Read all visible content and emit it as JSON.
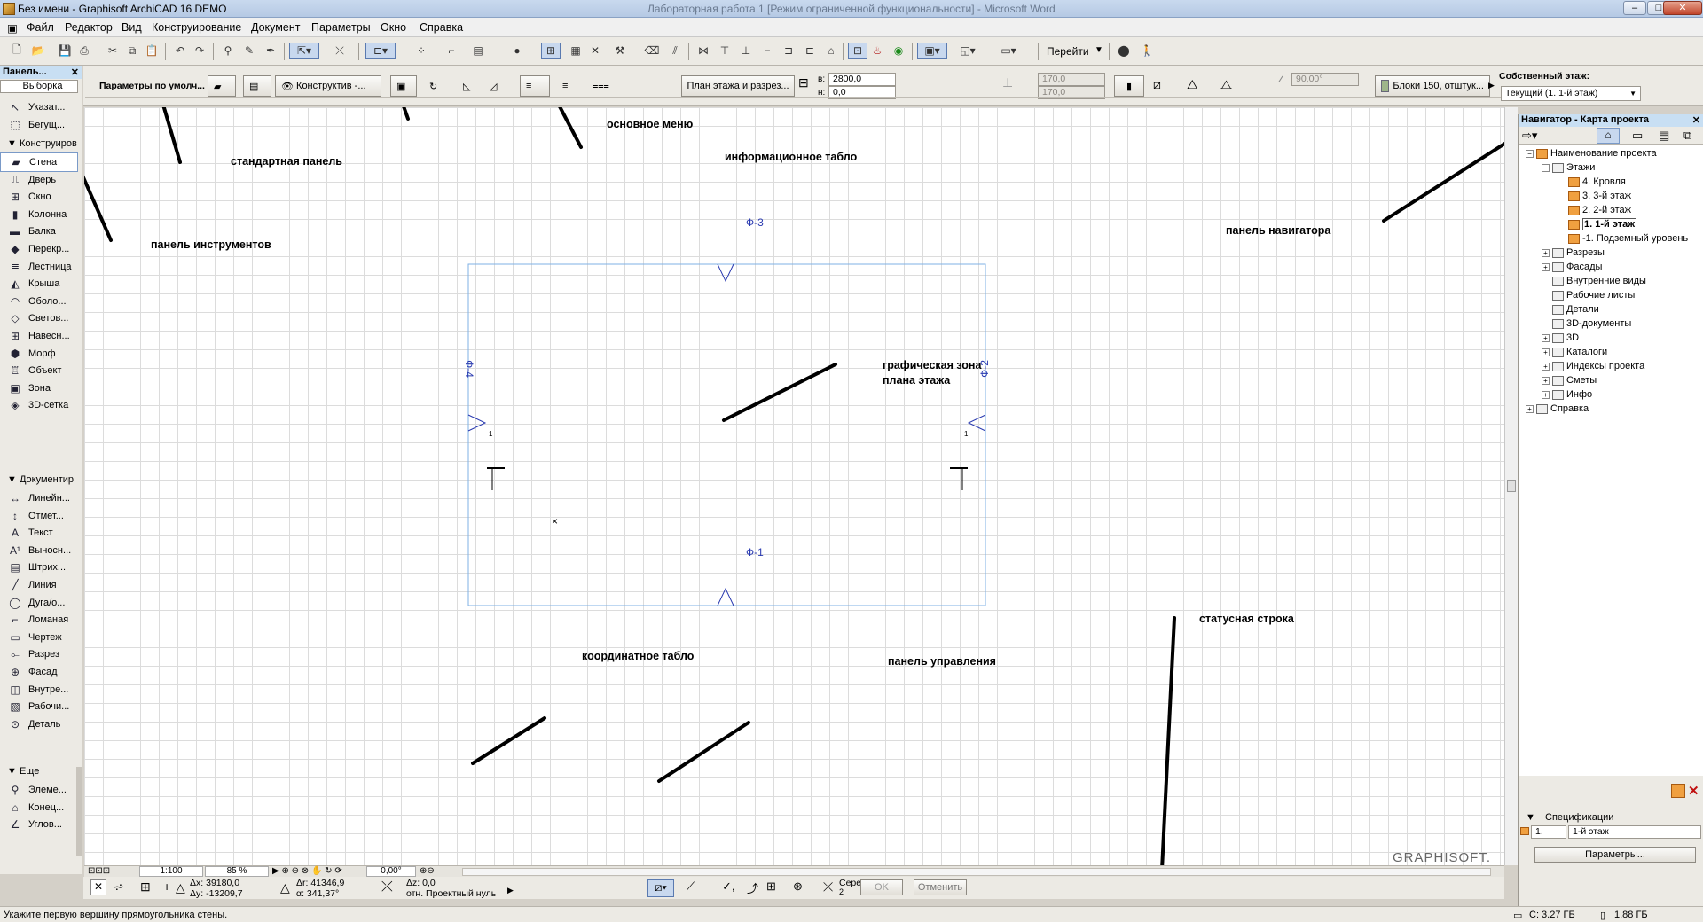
{
  "window": {
    "title": "Без имени - Graphisoft ArchiCAD 16 DEMO",
    "bg_title": "Лабораторная работа 1 [Режим ограниченной функциональности] - Microsoft Word",
    "min": "–",
    "max": "□",
    "close": "✕"
  },
  "menubar": [
    "Файл",
    "Редактор",
    "Вид",
    "Конструирование",
    "Документ",
    "Параметры",
    "Окно",
    "Справка"
  ],
  "toolbar": {
    "goto_label": "Перейти"
  },
  "toolpanel": {
    "title": "Панель...",
    "select_header": "Выборка",
    "select_items": [
      {
        "icon": "arrow-icon",
        "glyph": "↖",
        "label": "Указат..."
      },
      {
        "icon": "marquee-icon",
        "glyph": "⬚",
        "label": "Бегущ..."
      }
    ],
    "design_header": "Конструиров",
    "design_items": [
      {
        "icon": "wall-icon",
        "glyph": "▰",
        "label": "Стена"
      },
      {
        "icon": "door-icon",
        "glyph": "⎍",
        "label": "Дверь"
      },
      {
        "icon": "window-icon",
        "glyph": "⊞",
        "label": "Окно"
      },
      {
        "icon": "column-icon",
        "glyph": "▮",
        "label": "Колонна"
      },
      {
        "icon": "beam-icon",
        "glyph": "▬",
        "label": "Балка"
      },
      {
        "icon": "slab-icon",
        "glyph": "◆",
        "label": "Перекр..."
      },
      {
        "icon": "stair-icon",
        "glyph": "≣",
        "label": "Лестница"
      },
      {
        "icon": "roof-icon",
        "glyph": "◭",
        "label": "Крыша"
      },
      {
        "icon": "shell-icon",
        "glyph": "◠",
        "label": "Оболо..."
      },
      {
        "icon": "skylight-icon",
        "glyph": "◇",
        "label": "Светов..."
      },
      {
        "icon": "curtainwall-icon",
        "glyph": "⊞",
        "label": "Навесн..."
      },
      {
        "icon": "morph-icon",
        "glyph": "⬢",
        "label": "Морф"
      },
      {
        "icon": "object-icon",
        "glyph": "♖",
        "label": "Объект"
      },
      {
        "icon": "zone-icon",
        "glyph": "▣",
        "label": "Зона"
      },
      {
        "icon": "mesh-icon",
        "glyph": "◈",
        "label": "3D-сетка"
      }
    ],
    "doc_header": "Документир",
    "doc_items": [
      {
        "icon": "dimension-icon",
        "glyph": "↔",
        "label": "Линейн..."
      },
      {
        "icon": "level-icon",
        "glyph": "↕",
        "label": "Отмет..."
      },
      {
        "icon": "text-icon",
        "glyph": "A",
        "label": "Текст"
      },
      {
        "icon": "label-icon",
        "glyph": "A¹",
        "label": "Выносн..."
      },
      {
        "icon": "hatch-icon",
        "glyph": "▤",
        "label": "Штрих..."
      },
      {
        "icon": "line-icon",
        "glyph": "╱",
        "label": "Линия"
      },
      {
        "icon": "arc-icon",
        "glyph": "◯",
        "label": "Дуга/о..."
      },
      {
        "icon": "polyline-icon",
        "glyph": "⌐",
        "label": "Ломаная"
      },
      {
        "icon": "drawing-icon",
        "glyph": "▭",
        "label": "Чертеж"
      },
      {
        "icon": "section-icon",
        "glyph": "⟜",
        "label": "Разрез"
      },
      {
        "icon": "elevation-icon",
        "glyph": "⊕",
        "label": "Фасад"
      },
      {
        "icon": "interior-icon",
        "glyph": "◫",
        "label": "Внутре..."
      },
      {
        "icon": "worksheet-icon",
        "glyph": "▧",
        "label": "Рабочи..."
      },
      {
        "icon": "detail-icon",
        "glyph": "⊙",
        "label": "Деталь"
      }
    ],
    "more_header": "Еще",
    "more_items": [
      {
        "icon": "elements-icon",
        "glyph": "⚲",
        "label": "Элеме..."
      },
      {
        "icon": "endpoint-icon",
        "glyph": "⌂",
        "label": "Конец..."
      },
      {
        "icon": "angle-icon",
        "glyph": "∠",
        "label": "Углов..."
      }
    ]
  },
  "infobox": {
    "default_params": "Параметры по умолч...",
    "construction": "Конструктив -...",
    "floor_plan_section": "План этажа и разрез...",
    "top_label": "в:",
    "top_value": "2800,0",
    "bottom_label": "н:",
    "bottom_value": "0,0",
    "thick1": "170,0",
    "thick2": "170,0",
    "angle": "90,00°",
    "material": "Блоки 150, отштук...",
    "home_story_label": "Собственный этаж:",
    "home_story_value": "Текущий (1. 1-й этаж)"
  },
  "annotations": {
    "main_menu": "основное меню",
    "standard_panel": "стандартная панель",
    "info_box": "информационное табло",
    "tool_panel": "панель инструментов",
    "navigator_panel": "панель навигатора",
    "graphic_zone_1": "графическая зона",
    "graphic_zone_2": "плана этажа",
    "status_line": "статусная строка",
    "coord_box": "координатное табло",
    "control_panel": "панель управления"
  },
  "drawing": {
    "marker_top": "Ф-3",
    "marker_bottom": "Ф-1",
    "marker_left": "Ф-4",
    "marker_right": "Ф-2",
    "section_num_left": "1",
    "section_num_right": "1",
    "watermark": "GRAPHISOFT."
  },
  "navigator": {
    "title": "Навигатор - Карта проекта",
    "tree": [
      {
        "label": "Наименование проекта",
        "level": 0,
        "exp": "−",
        "icon": "project-icon"
      },
      {
        "label": "Этажи",
        "level": 1,
        "exp": "−",
        "icon": "stories-icon"
      },
      {
        "label": "4. Кровля",
        "level": 2,
        "exp": "",
        "icon": "story-icon"
      },
      {
        "label": "3. 3-й этаж",
        "level": 2,
        "exp": "",
        "icon": "story-icon"
      },
      {
        "label": "2. 2-й этаж",
        "level": 2,
        "exp": "",
        "icon": "story-icon"
      },
      {
        "label": "1. 1-й этаж",
        "level": 2,
        "exp": "",
        "icon": "story-icon",
        "current": true
      },
      {
        "label": "-1. Подземный уровень",
        "level": 2,
        "exp": "",
        "icon": "story-icon"
      },
      {
        "label": "Разрезы",
        "level": 1,
        "exp": "+",
        "icon": "sections-icon"
      },
      {
        "label": "Фасады",
        "level": 1,
        "exp": "+",
        "icon": "elevations-icon"
      },
      {
        "label": "Внутренние виды",
        "level": 1,
        "exp": "",
        "icon": "interior-elevations-icon"
      },
      {
        "label": "Рабочие листы",
        "level": 1,
        "exp": "",
        "icon": "worksheets-icon"
      },
      {
        "label": "Детали",
        "level": 1,
        "exp": "",
        "icon": "details-icon"
      },
      {
        "label": "3D-документы",
        "level": 1,
        "exp": "",
        "icon": "3d-documents-icon"
      },
      {
        "label": "3D",
        "level": 1,
        "exp": "+",
        "icon": "3d-icon"
      },
      {
        "label": "Каталоги",
        "level": 1,
        "exp": "+",
        "icon": "schedules-icon"
      },
      {
        "label": "Индексы проекта",
        "level": 1,
        "exp": "+",
        "icon": "project-indexes-icon"
      },
      {
        "label": "Сметы",
        "level": 1,
        "exp": "+",
        "icon": "lists-icon"
      },
      {
        "label": "Инфо",
        "level": 1,
        "exp": "+",
        "icon": "info-icon"
      },
      {
        "label": "Справка",
        "level": 0,
        "exp": "+",
        "icon": "help-icon"
      }
    ],
    "specs_header": "Спецификации",
    "specs_num": "1.",
    "specs_name": "1-й этаж",
    "params_button": "Параметры..."
  },
  "canvasctrl": {
    "scale": "1:100",
    "zoom": "85 %",
    "angle": "0,00°"
  },
  "coordbar": {
    "dx": "Δx: 39180,0",
    "dy": "Δy: -13209,7",
    "dr": "Δr: 41346,9",
    "da": "α: 341,37°",
    "dz": "Δz: 0,0",
    "rel": "отн. Проектный нуль",
    "midpoint": "Середина",
    "midpoint_n": "2",
    "ok": "OK",
    "cancel": "Отменить"
  },
  "status": {
    "message": "Укажите первую вершину прямоугольника стены.",
    "disk": "C: 3.27 ГБ",
    "ram": "1.88 ГБ"
  },
  "colors": {
    "grid": "#dcdcdc",
    "guide_blue": "#7fb2e6",
    "marker_blue": "#2a3ab0",
    "accent_header": "#c8dff3"
  }
}
